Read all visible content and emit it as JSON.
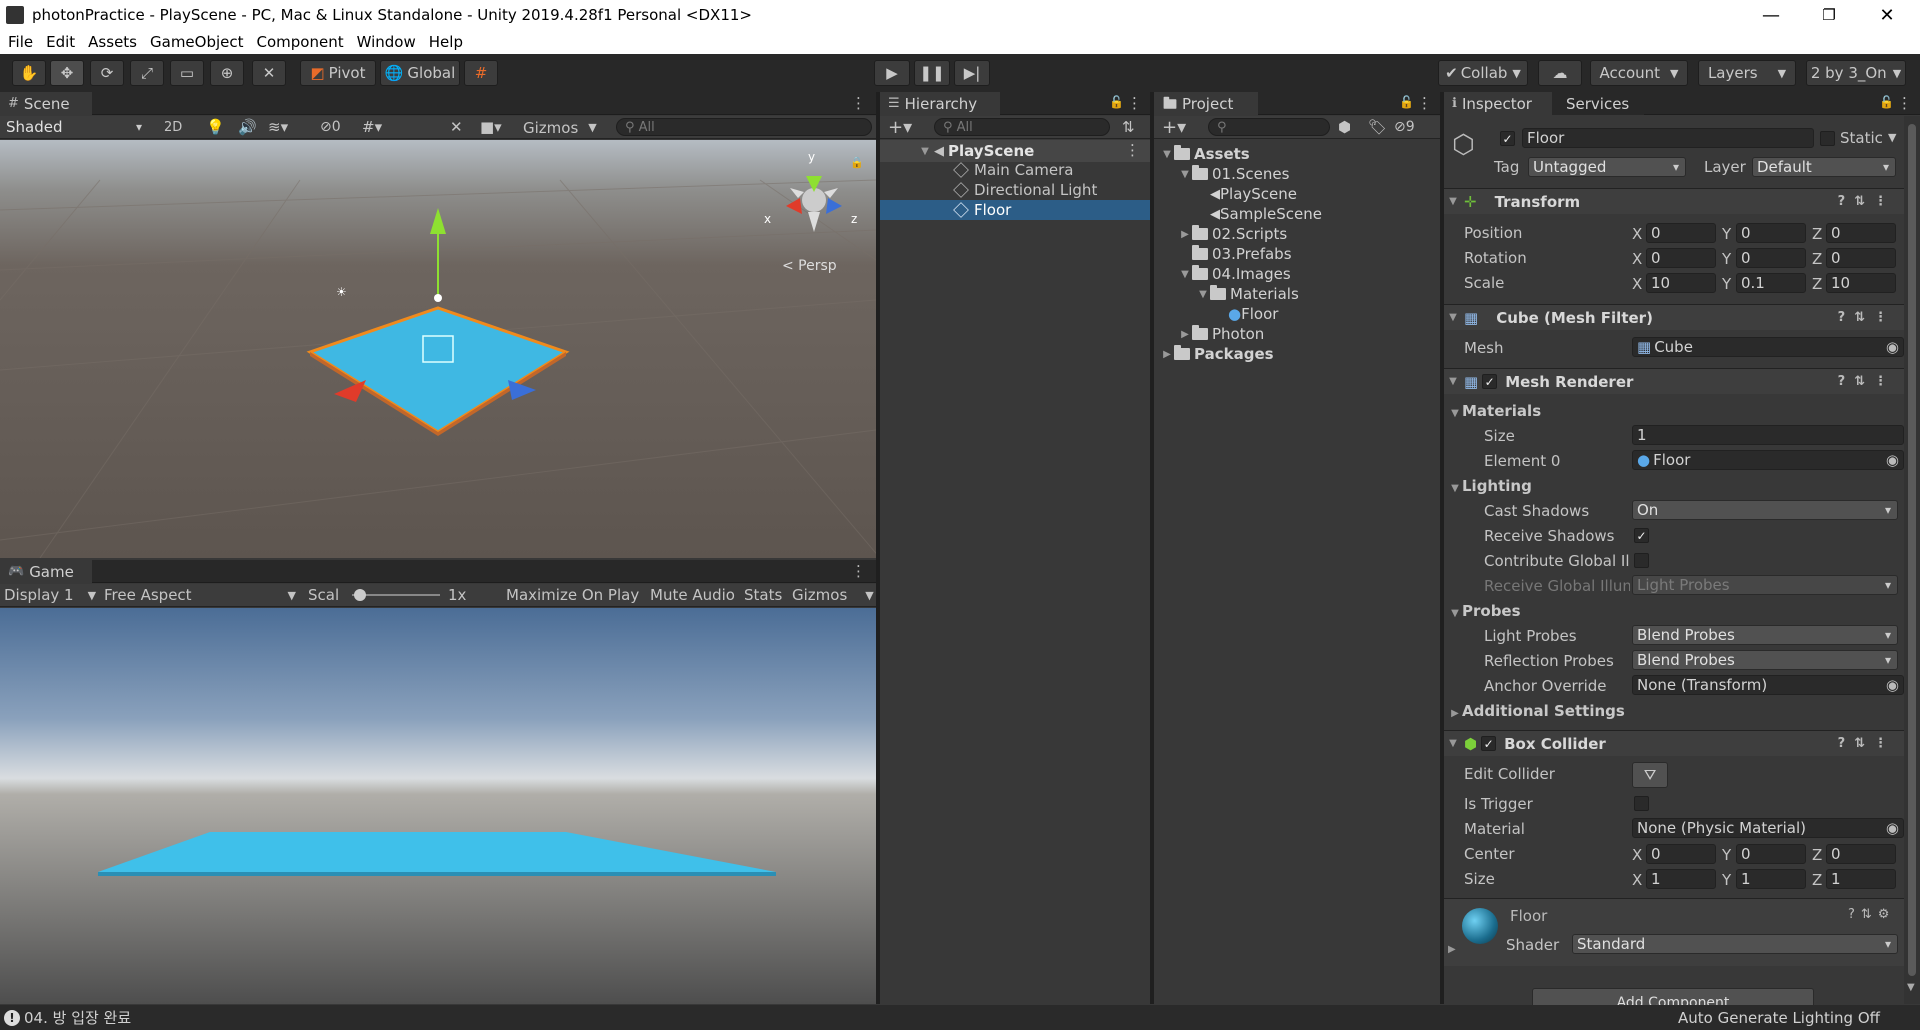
{
  "window": {
    "title": "photonPractice - PlayScene - PC, Mac & Linux Standalone - Unity 2019.4.28f1 Personal <DX11>",
    "controls": [
      "—",
      "❐",
      "✕"
    ]
  },
  "menu": [
    "File",
    "Edit",
    "Assets",
    "GameObject",
    "Component",
    "Window",
    "Help"
  ],
  "toolbar": {
    "pivot": "Pivot",
    "global": "Global",
    "collab": "Collab",
    "account": "Account",
    "layers": "Layers",
    "layout": "2 by 3_On"
  },
  "scene": {
    "tab": "Scene",
    "shading": "Shaded",
    "mode2d": "2D",
    "hidden_count": "0",
    "gizmos": "Gizmos",
    "search_placeholder": "All",
    "persp": "< Persp",
    "axis_x": "x",
    "axis_z": "z",
    "axis_y": "y"
  },
  "game": {
    "tab": "Game",
    "display": "Display 1",
    "aspect": "Free Aspect",
    "scale_label": "Scal",
    "scale_value": "1x",
    "maximize": "Maximize On Play",
    "mute": "Mute Audio",
    "stats": "Stats",
    "gizmos": "Gizmos"
  },
  "hierarchy": {
    "tab": "Hierarchy",
    "search_placeholder": "All",
    "scene": "PlayScene",
    "items": [
      "Main Camera",
      "Directional Light",
      "Floor"
    ],
    "selected": "Floor"
  },
  "project": {
    "tab": "Project",
    "badge": "9",
    "tree": [
      {
        "label": "Assets",
        "depth": 0,
        "open": true,
        "type": "folder"
      },
      {
        "label": "01.Scenes",
        "depth": 1,
        "open": true,
        "type": "folder"
      },
      {
        "label": "PlayScene",
        "depth": 2,
        "type": "scene"
      },
      {
        "label": "SampleScene",
        "depth": 2,
        "type": "scene"
      },
      {
        "label": "02.Scripts",
        "depth": 1,
        "open": false,
        "type": "folder"
      },
      {
        "label": "03.Prefabs",
        "depth": 1,
        "type": "folder"
      },
      {
        "label": "04.Images",
        "depth": 1,
        "open": true,
        "type": "folder"
      },
      {
        "label": "Materials",
        "depth": 2,
        "open": true,
        "type": "folder"
      },
      {
        "label": "Floor",
        "depth": 3,
        "type": "material"
      },
      {
        "label": "Photon",
        "depth": 1,
        "open": false,
        "type": "folder"
      },
      {
        "label": "Packages",
        "depth": 0,
        "open": false,
        "type": "folder"
      }
    ]
  },
  "inspector": {
    "tab": "Inspector",
    "tab2": "Services",
    "name": "Floor",
    "static": "Static",
    "tag_label": "Tag",
    "tag": "Untagged",
    "layer_label": "Layer",
    "layer": "Default",
    "transform": {
      "title": "Transform",
      "position_label": "Position",
      "position": [
        "0",
        "0",
        "0"
      ],
      "rotation_label": "Rotation",
      "rotation": [
        "0",
        "0",
        "0"
      ],
      "scale_label": "Scale",
      "scale": [
        "10",
        "0.1",
        "10"
      ]
    },
    "mesh_filter": {
      "title": "Cube (Mesh Filter)",
      "mesh_label": "Mesh",
      "mesh": "Cube"
    },
    "mesh_renderer": {
      "title": "Mesh Renderer",
      "materials": "Materials",
      "size_label": "Size",
      "size": "1",
      "element0_label": "Element 0",
      "element0": "Floor",
      "lighting": "Lighting",
      "cast_shadows_label": "Cast Shadows",
      "cast_shadows": "On",
      "receive_shadows_label": "Receive Shadows",
      "contribute_gi_label": "Contribute Global Illu",
      "receive_gi_label": "Receive Global Illum",
      "receive_gi": "Light Probes",
      "probes": "Probes",
      "light_probes_label": "Light Probes",
      "light_probes": "Blend Probes",
      "reflection_probes_label": "Reflection Probes",
      "reflection_probes": "Blend Probes",
      "anchor_label": "Anchor Override",
      "anchor": "None (Transform)",
      "additional": "Additional Settings"
    },
    "box_collider": {
      "title": "Box Collider",
      "edit_label": "Edit Collider",
      "trigger_label": "Is Trigger",
      "material_label": "Material",
      "material": "None (Physic Material)",
      "center_label": "Center",
      "center": [
        "0",
        "0",
        "0"
      ],
      "size_label": "Size",
      "size": [
        "1",
        "1",
        "1"
      ]
    },
    "material": {
      "name": "Floor",
      "shader_label": "Shader",
      "shader": "Standard"
    },
    "add_component": "Add Component",
    "axes": [
      "X",
      "Y",
      "Z"
    ]
  },
  "status": {
    "message": "04. 방 입장 완료",
    "lighting": "Auto Generate Lighting Off"
  },
  "colors": {
    "floor": "#3fb8e3",
    "selection": "#2c5d87",
    "accent_orange": "#f08a1c"
  }
}
